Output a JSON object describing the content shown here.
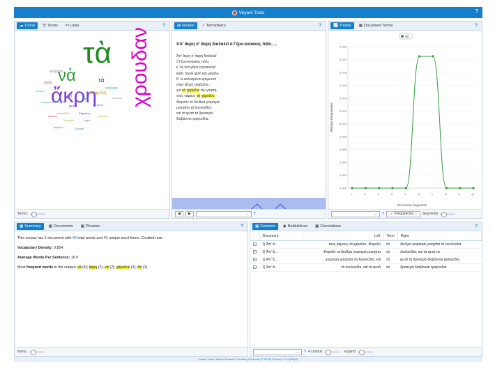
{
  "app": {
    "title": "Voyant Tools",
    "help": "?"
  },
  "cirrus": {
    "tabs": [
      "Cirrus",
      "Terms",
      "Links"
    ],
    "words": [
      {
        "t": "τὰ",
        "c": "#1f8a1f"
      },
      {
        "t": "ἄκρη",
        "c": "#7a3fd6"
      },
      {
        "t": "νὰ",
        "c": "#2e9e3a"
      },
      {
        "t": "χρουδαν",
        "c": "#e000c8"
      },
      {
        "t": "τά",
        "c": "#1a3cc9"
      },
      {
        "t": "γιοφύλαξ",
        "c": "#c7a21e"
      },
      {
        "t": "κὶ",
        "c": "#e03c3c"
      },
      {
        "t": "Γέρο",
        "c": "#4aa0e0"
      },
      {
        "t": "κουβαλᾶ",
        "c": "#888"
      },
      {
        "t": "χαρὰ",
        "c": "#c03c8c"
      },
      {
        "t": "πάλι",
        "c": "#2e9e9e"
      },
      {
        "t": "φυτά",
        "c": "#8c3cc0"
      },
      {
        "t": "μοσχάτα",
        "c": "#3c8cc0"
      },
      {
        "t": "λουκούδια",
        "c": "#c08c3c"
      },
      {
        "t": "σαλονια",
        "c": "#3cc08c"
      },
      {
        "t": "κόλπος",
        "c": "#c03c3c"
      },
      {
        "t": "θλιμμένη",
        "c": "#3c3cc0"
      },
      {
        "t": "δροσερὸ",
        "c": "#8cc03c"
      },
      {
        "t": "διαλαλεῖ",
        "c": "#c0c03c"
      },
      {
        "t": "δένδρα",
        "c": "#3cc0c0"
      },
      {
        "t": "γάμο",
        "c": "#c03cc0"
      },
      {
        "t": "κούκκος",
        "c": "#999"
      },
      {
        "t": "πτεργόσσεα",
        "c": "#5a8"
      },
      {
        "t": "φορούν",
        "c": "#a58"
      },
      {
        "t": "ζευγάρι",
        "c": "#58a"
      }
    ],
    "footer_label": "Terms:"
  },
  "reader": {
    "tabs": [
      "Reader",
      "TermsBerry"
    ],
    "title": "Ἀπ' ἄκρη σ' ἄκρη διαλαλεῖ ὁ Γέρο-κούκκος πάλι, ...",
    "lines": [
      "Ἀπ' ἄκρη σ' ἄκρη διαλαλεῖ",
      "ὁ Γέρο-κούκκος πάλι,",
      "κ' ὅς ἕνα γάμο προσκαλεῖ",
      "κάθε πουλὶ ψιλὸ καὶ μεγάλο.",
      "Κ' οἱ καλεσμένοι φτερωτοὶ",
      "στὴν ἐξοχὴ τραβοῦνε,",
      "γιὰ νὰ χαροῦνε τὴν γιορτή,",
      "τοὺς γάμους νὰ χαροῦνε.",
      "Φοροῦν τὰ δένδρα γιορτερὰ",
      "μοσχάτα τὰ λουλούδια,",
      "καὶ τὰ φυτὰ τὰ δροσερὰ",
      "διαβάνναι τραγούδια."
    ],
    "highlight_word": "χαροῦνε",
    "highlight_word2": "νὰ",
    "search_placeholder": "",
    "search_help": "?"
  },
  "trends": {
    "tabs": [
      "Trends",
      "Document Terms"
    ],
    "legend": "νὰ",
    "ylabel": "Relative Frequencies",
    "xlabel": "Document Segments",
    "freq_button": "Frequencies",
    "segments_label": "Segments",
    "combo_help": "?"
  },
  "chart_data": {
    "type": "line",
    "title": "",
    "xlabel": "Document Segments",
    "ylabel": "Relative Frequencies",
    "x": [
      1,
      2,
      3,
      4,
      5,
      6,
      7,
      8,
      9,
      10
    ],
    "series": [
      {
        "name": "νὰ",
        "values": [
          0,
          0,
          0,
          0,
          0,
          0.0205,
          0.0205,
          0,
          0,
          0
        ]
      }
    ],
    "ylim": [
      0,
      0.022
    ],
    "yticks": [
      "0.000",
      "0.002",
      "0.004",
      "0.006",
      "0.008",
      "0.010",
      "0.012",
      "0.014",
      "0.016",
      "0.018",
      "0.020",
      "0.022"
    ],
    "xticks": [
      "1",
      "2",
      "3",
      "4",
      "5",
      "6",
      "7",
      "8",
      "9",
      "10"
    ],
    "grid": true,
    "legend": "top-center",
    "color": "#2e9e3a"
  },
  "summary": {
    "tabs": [
      "Summary",
      "Documents",
      "Phrases"
    ],
    "line1_pre": "This corpus has 1 document with ",
    "total_words": "48",
    "line1_mid": " total words and ",
    "unique_words": "41",
    "line1_post": " unique word forms. Created now.",
    "vd_label": "Vocabulary Density:",
    "vd_value": "0.854",
    "aw_label": "Average Words Per Sentence:",
    "aw_value": "16.0",
    "mf_label_pre": "Most ",
    "mf_label_bold": "frequent words",
    "mf_label_post": " in the corpus: ",
    "freq_words": [
      {
        "w": "νὰ",
        "n": " (4); "
      },
      {
        "w": "ἄκρη",
        "n": " (2); "
      },
      {
        "w": "νὰ",
        "n": " (2); "
      },
      {
        "w": "χαροῦνε",
        "n": " (2); "
      },
      {
        "w": "ὅτι",
        "n": " (1)"
      }
    ],
    "items_label": "Items:"
  },
  "contexts": {
    "tabs": [
      "Contexts",
      "Bubblelines",
      "Correlations"
    ],
    "columns": [
      "Document",
      "Left",
      "Term",
      "Right"
    ],
    "rows": [
      {
        "doc": "1) Ἀπ' ἄ...",
        "left": "τοὺς γάμους νὰ χαροῦνε. Φοροῦν",
        "term": "τὰ",
        "right": "δένδρα γιορτερὰ μοσχάτα τὰ λουλούδια"
      },
      {
        "doc": "1) Ἀπ' ἄ...",
        "left": "Φοροῦν τὰ δένδρα γιορτερὰ μοσχάτα",
        "term": "τὰ",
        "right": "λουλούδια, καὶ τὰ φυτὰ τὰ"
      },
      {
        "doc": "1) Ἀπ' ἄ...",
        "left": "γιορτερὰ μοσχάτα τὰ λουλούδια, καὶ",
        "term": "τὰ",
        "right": "φυτὰ τὰ δροσερὰ διαβάνναι τραγούδια"
      },
      {
        "doc": "1) Ἀπ' ἄ...",
        "left": "τὰ λουλούδια, καὶ τὰ φυτὰ",
        "term": "τὰ",
        "right": "δροσερὰ διαβάνναι τραγούδια"
      }
    ],
    "context_value": "4",
    "context_label": "context",
    "expand_label": "expand",
    "help": "?"
  },
  "footer": "Voyant Tools, Stéfan Sinclair & Geoffrey Rockwell (© 2016) Privacy v. 2.4 (M6p1)"
}
